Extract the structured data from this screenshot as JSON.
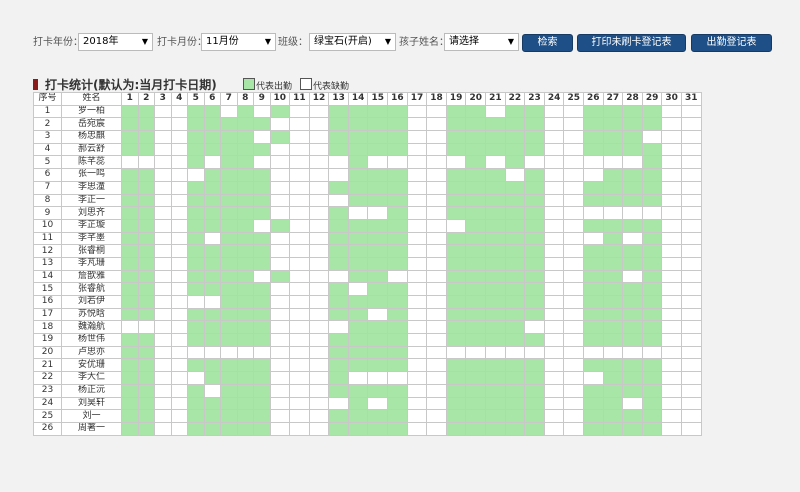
{
  "filters": {
    "year_label": "打卡年份：",
    "year_value": "2018年",
    "month_label": "打卡月份：",
    "month_value": "11月份",
    "class_label": "班级：",
    "class_value": "绿宝石(开启)",
    "child_label": "孩子姓名：",
    "child_value": "请选择",
    "arrow": "▼"
  },
  "buttons": {
    "search": "检索",
    "print_missing": "打印未刷卡登记表",
    "attendance_sheet": "出勤登记表"
  },
  "section": {
    "title": "打卡统计(默认为:当月打卡日期)",
    "legend_present": "代表出勤",
    "legend_absent": "代表缺勤",
    "present_color": "#a8e6a8",
    "absent_color": "#ffffff"
  },
  "table": {
    "col_index": "序号",
    "col_name": "姓名",
    "days": [
      "1",
      "2",
      "3",
      "4",
      "5",
      "6",
      "7",
      "8",
      "9",
      "10",
      "11",
      "12",
      "13",
      "14",
      "15",
      "16",
      "17",
      "18",
      "19",
      "20",
      "21",
      "22",
      "23",
      "24",
      "25",
      "26",
      "27",
      "28",
      "29",
      "30",
      "31"
    ],
    "rows": [
      {
        "no": "1",
        "name": "罗一柏",
        "att": "1100110101001111001101100111100"
      },
      {
        "no": "2",
        "name": "岳宛宸",
        "att": "1100111110001111001111100111100"
      },
      {
        "no": "3",
        "name": "杨忠麒",
        "att": "1100111101001111001111100111000"
      },
      {
        "no": "4",
        "name": "郝云舒",
        "att": "1100111110001111001111100111100"
      },
      {
        "no": "5",
        "name": "陈芊蕊",
        "att": "0000101100000100000101000000100"
      },
      {
        "no": "6",
        "name": "张一鸣",
        "att": "1100011110000111001110100011100"
      },
      {
        "no": "7",
        "name": "李思潼",
        "att": "1100111110001111001111100111100"
      },
      {
        "no": "8",
        "name": "李正一",
        "att": "1100111110000111001111100111100"
      },
      {
        "no": "9",
        "name": "刘思齐",
        "att": "1100111110001001001111100000000"
      },
      {
        "no": "10",
        "name": "李芷璇",
        "att": "1100111101001111000111100111100"
      },
      {
        "no": "11",
        "name": "李芊墨",
        "att": "1100101110001111001111100010100"
      },
      {
        "no": "12",
        "name": "张睿桐",
        "att": "1100111110001111001111100111100"
      },
      {
        "no": "13",
        "name": "李芃珊",
        "att": "1100111110001111001111100111100"
      },
      {
        "no": "14",
        "name": "詹歆雅",
        "att": "1100111101000110001111100110100"
      },
      {
        "no": "15",
        "name": "张睿航",
        "att": "1100111110001011001111100111100"
      },
      {
        "no": "16",
        "name": "刘若伊",
        "att": "1100001110001111001111100111100"
      },
      {
        "no": "17",
        "name": "苏悦晗",
        "att": "1100111110001101001111100111100"
      },
      {
        "no": "18",
        "name": "魏瀚航",
        "att": "0000111110000111001111000111100"
      },
      {
        "no": "19",
        "name": "杨世伟",
        "att": "1100111110001111001111100111100"
      },
      {
        "no": "20",
        "name": "卢思亦",
        "att": "1100000000001111000000000000000"
      },
      {
        "no": "21",
        "name": "安优珊",
        "att": "1100111110001111001111100111100"
      },
      {
        "no": "22",
        "name": "李大仁",
        "att": "1100011110001000001111100011100"
      },
      {
        "no": "23",
        "name": "杨正沅",
        "att": "1100101110001111001111100111100"
      },
      {
        "no": "24",
        "name": "刘昊轩",
        "att": "1100111110000101001111100110100"
      },
      {
        "no": "25",
        "name": "刘一",
        "att": "1100111110001111001111100111100"
      },
      {
        "no": "26",
        "name": "周著一",
        "att": "1100111110001111001111100111100"
      }
    ]
  }
}
